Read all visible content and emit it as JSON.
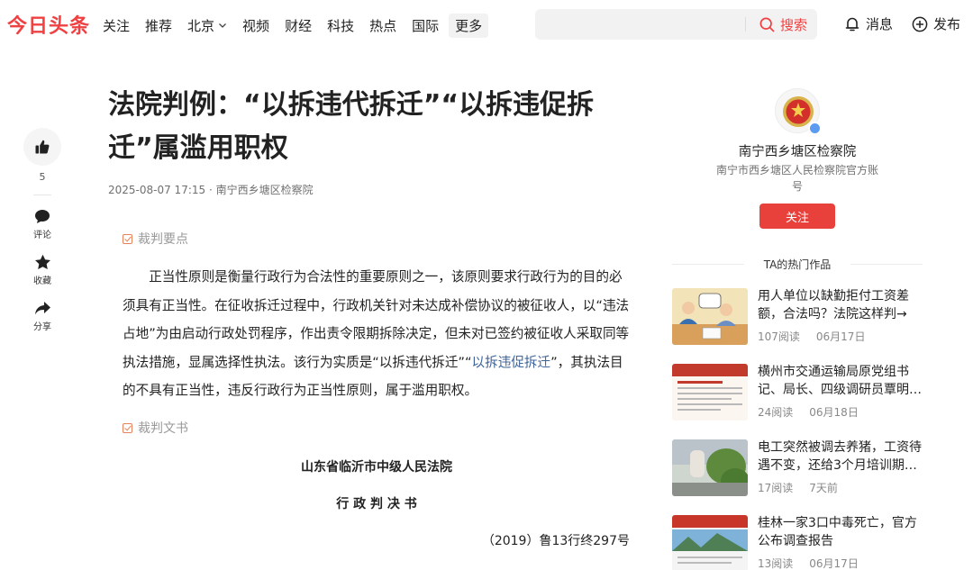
{
  "header": {
    "logo": "今日头条",
    "nav": [
      "关注",
      "推荐",
      "北京",
      "视频",
      "财经",
      "科技",
      "热点",
      "国际"
    ],
    "more": "更多",
    "search_button": "搜索",
    "messages": "消息",
    "publish": "发布"
  },
  "rail": {
    "like_count": "5",
    "comment": "评论",
    "favorite": "收藏",
    "share": "分享"
  },
  "article": {
    "title": "法院判例：“以拆违代拆迁”“以拆违促拆迁”属滥用职权",
    "date": "2025-08-07 17:15",
    "source": "南宁西乡塘区检察院",
    "section1": "裁判要点",
    "para_part1": "正当性原则是衡量行政行为合法性的重要原则之一，该原则要求行政行为的目的必须具有正当性。在征收拆迁过程中，行政机关针对未达成补偿协议的被征收人，以“违法占地”为由启动行政处罚程序，作出责令限期拆除决定，但未对已签约被征收人采取同等执法措施，显属选择性执法。该行为实质是“以拆违代拆迁”“",
    "para_link": "以拆违促拆迁",
    "para_part2": "”，其执法目的不具有正当性，违反行政行为正当性原则，属于滥用职权。",
    "section2": "裁判文书",
    "court": "山东省临沂市中级人民法院",
    "doc_type": "行 政 判 决 书",
    "case_no": "（2019）鲁13行终297号"
  },
  "author": {
    "name": "南宁西乡塘区检察院",
    "desc": "南宁市西乡塘区人民检察院官方账号",
    "follow": "关注"
  },
  "hot": {
    "title": "TA的热门作品",
    "items": [
      {
        "text": "用人单位以缺勤拒付工资差额，合法吗？法院这样判→",
        "reads": "107阅读",
        "date": "06月17日"
      },
      {
        "text": "横州市交通运输局原党组书记、局长、四级调研员覃明…",
        "reads": "24阅读",
        "date": "06月18日"
      },
      {
        "text": "电工突然被调去养猪，工资待遇不变，还给3个月培训期…",
        "reads": "17阅读",
        "date": "7天前"
      },
      {
        "text": "桂林一家3口中毒死亡，官方公布调查报告",
        "reads": "13阅读",
        "date": "06月17日"
      }
    ]
  },
  "colors": {
    "brand_red": "#f04142",
    "link_blue": "#406599",
    "follow_red": "#e8413c"
  },
  "icons": [
    "search-icon",
    "bell-icon",
    "plus-circle-icon",
    "thumbs-up-icon",
    "comment-icon",
    "star-icon",
    "share-icon",
    "checkbox-icon",
    "verified-icon"
  ]
}
